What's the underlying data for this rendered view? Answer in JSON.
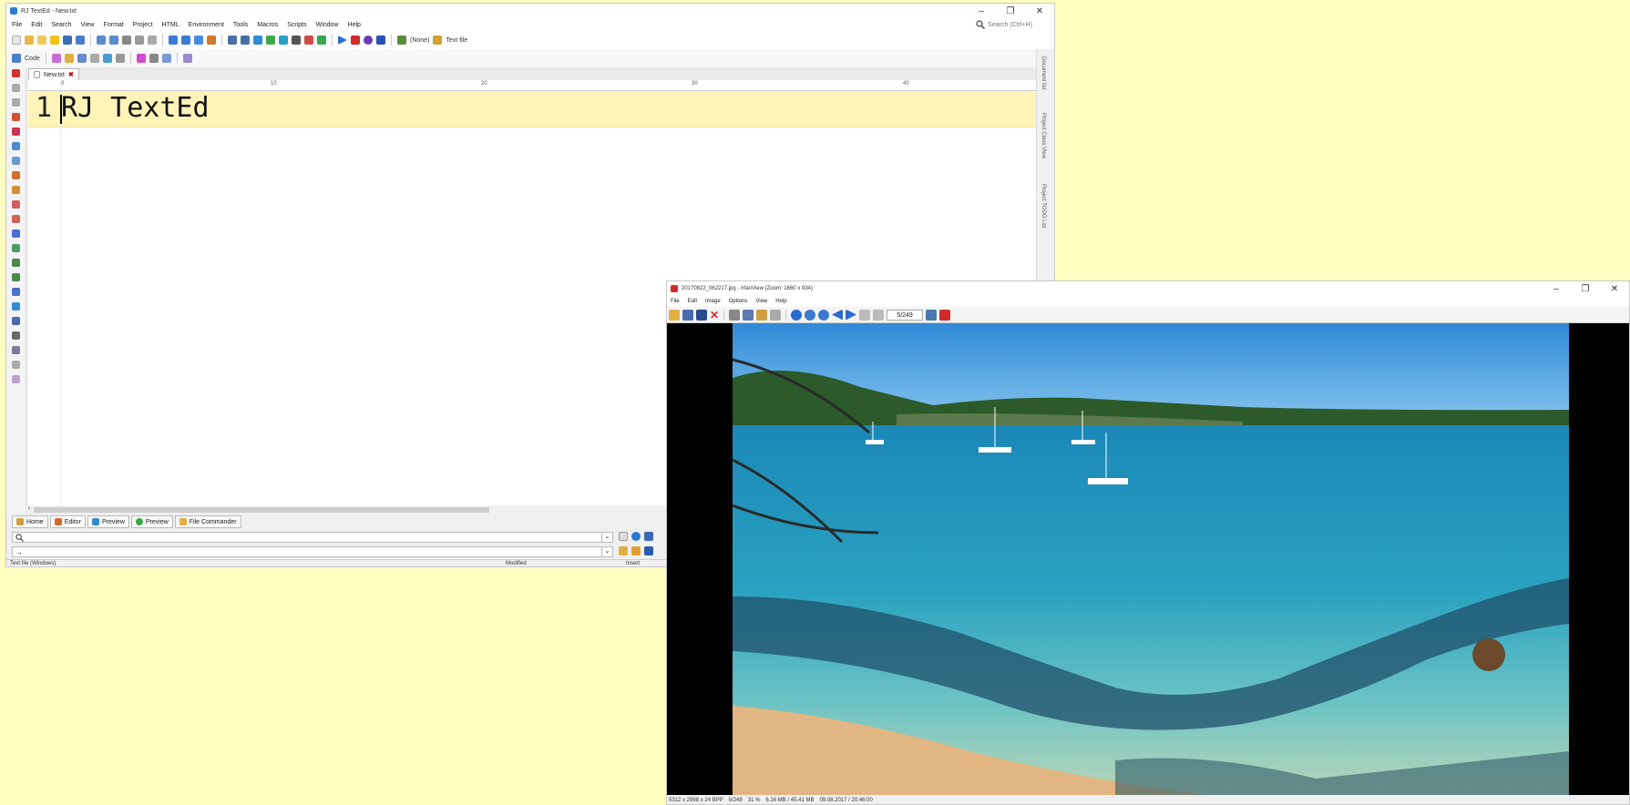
{
  "rjtexted": {
    "title": "RJ TextEd - New.txt",
    "menu": [
      "File",
      "Edit",
      "Search",
      "View",
      "Format",
      "Project",
      "HTML",
      "Environment",
      "Tools",
      "Macros",
      "Scripts",
      "Window",
      "Help"
    ],
    "search_placeholder": "Search (Ctrl+H)",
    "toolbar_none_label": "(None)",
    "toolbar_textfile_label": "Text file",
    "toolbar_code_label": "Code",
    "file_tab": "New.txt",
    "ruler_ticks": [
      "0",
      "10",
      "20",
      "30",
      "40"
    ],
    "line_number": "1",
    "code_line": "RJ TextEd",
    "side_panels": [
      "Document list",
      "Project Class View",
      "Project TODO List"
    ],
    "bottom_tabs": [
      "Home",
      "Editor",
      "Preview",
      "Preview",
      "File Commander"
    ],
    "cmd2_prefix": "→",
    "status": {
      "file_type": "Text file (Windows)",
      "modified": "Modified",
      "mode": "Insert"
    }
  },
  "irfanview": {
    "title": "20170822_062217.jpg - IrfanView (Zoom: 1660 x 934)",
    "menu": [
      "File",
      "Edit",
      "Image",
      "Options",
      "View",
      "Help"
    ],
    "page_counter": "5/249",
    "status": [
      "5312 x 2988 x 24 BPP",
      "5/249",
      "31 %",
      "6.16 MB / 45.41 MB",
      "09.08.2017 / 20:46:00"
    ]
  },
  "icons": {
    "sky_color": "#3d97d8",
    "water_color": "#1e8cb3",
    "sand_color": "#e2b683"
  }
}
